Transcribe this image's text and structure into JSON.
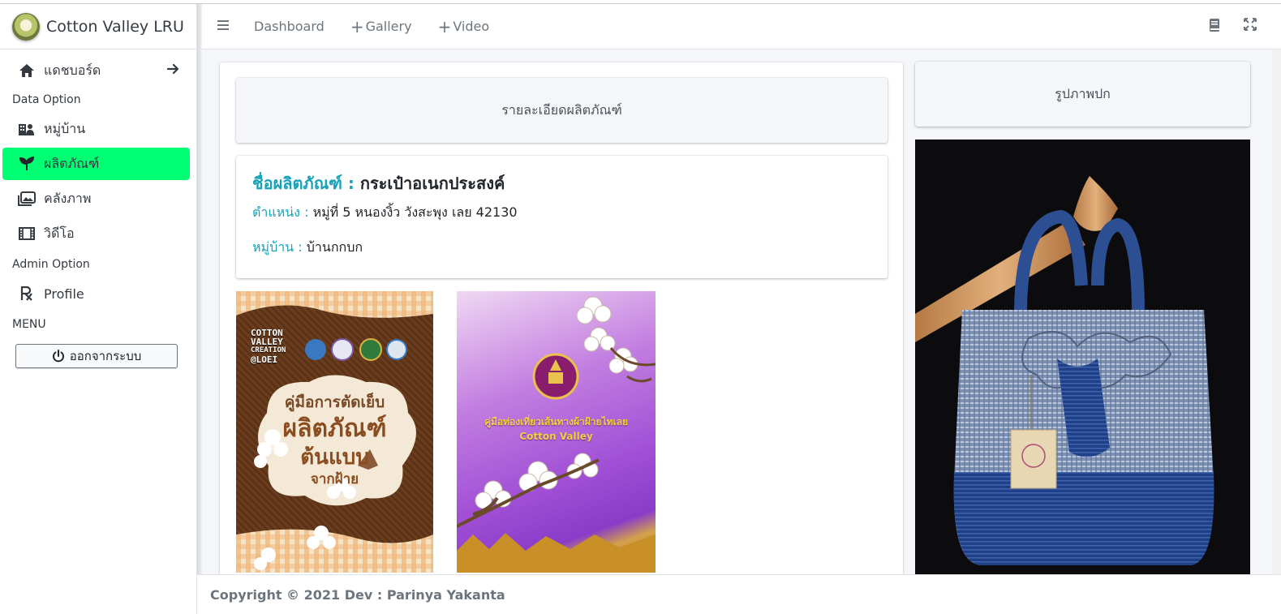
{
  "brand": {
    "title": "Cotton Valley LRU"
  },
  "sidebar": {
    "dashboard": "แดชบอร์ด",
    "section_data": "Data Option",
    "items": [
      {
        "label": "หมู่บ้าน",
        "icon": "village-icon"
      },
      {
        "label": "ผลิตภัณฑ์",
        "icon": "seedling-icon",
        "active": true
      },
      {
        "label": "คลังภาพ",
        "icon": "images-icon"
      },
      {
        "label": "วิดีโอ",
        "icon": "film-icon"
      }
    ],
    "section_admin": "Admin Option",
    "profile": "Profile",
    "section_menu": "MENU",
    "logout": "ออกจากระบบ"
  },
  "navbar": {
    "dashboard": "Dashboard",
    "gallery": "Gallery",
    "video": "Video"
  },
  "product": {
    "header": "รายละเอียดผลิตภัณฑ์",
    "name_label": "ชื่อผลิตภัณฑ์ :",
    "name": "กระเป๋าอเนกประสงค์",
    "location_label": "ตำแหน่ง :",
    "location": "หมู่ที่ 5 หนองงิ้ว วังสะพุง เลย 42130",
    "village_label": "หมู่บ้าน :",
    "village": "บ้านกกบก"
  },
  "thumbs": {
    "t1_brand": [
      "COTTON",
      "VALLEY",
      "CREATION",
      "@LOEI"
    ],
    "t1_title": "คู่มือการตัดเย็บ",
    "t1_big": "ผลิตภัณฑ์",
    "t1_big2": "ต้นแบบ",
    "t1_sub": "จากฝ้าย",
    "t2_title": "คู่มือท่องเที่ยวเส้นทางผ้าฝ้ายไทเลย",
    "t2_sub": "Cotton Valley"
  },
  "cover": {
    "header": "รูปภาพปก"
  },
  "footer": {
    "text": "Copyright © 2021 Dev : Parinya Yakanta"
  },
  "colors": {
    "accent_active": "#00ff73",
    "teal": "#17a2b8"
  }
}
